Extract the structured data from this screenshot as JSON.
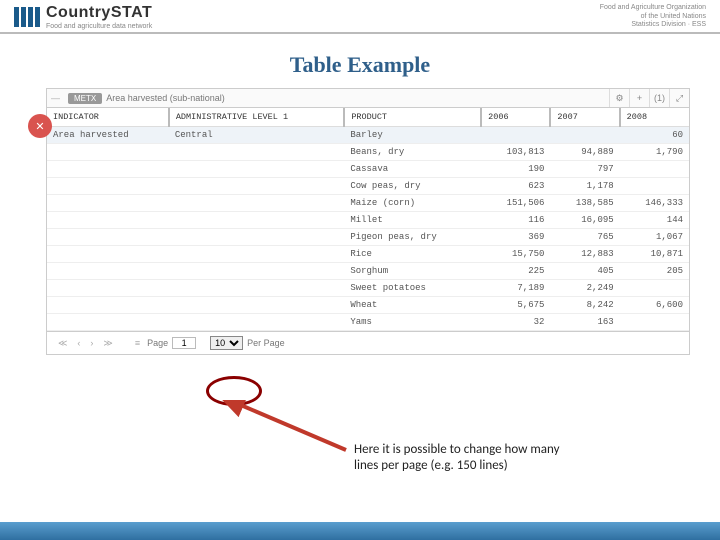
{
  "header": {
    "brand_main": "Country",
    "brand_stat": "STAT",
    "brand_sub": "Food and agriculture data network",
    "fao_line1": "Food and Agriculture Organization",
    "fao_line2": "of the United Nations",
    "fao_line3": "Statistics Division · ESS"
  },
  "title": "Table Example",
  "badge": "METX",
  "topic": "Area harvested (sub-national)",
  "toolbar_count": "(1)",
  "columns": {
    "c0": "INDICATOR",
    "c1": "ADMINISTRATIVE LEVEL 1",
    "c2": "PRODUCT",
    "c3": "2006",
    "c4": "2007",
    "c5": "2008"
  },
  "rows": [
    {
      "ind": "Area harvested",
      "admin": "Central",
      "prod": "Barley",
      "y06": "",
      "y07": "",
      "y08": "60",
      "hl": true
    },
    {
      "ind": "",
      "admin": "",
      "prod": "Beans, dry",
      "y06": "103,813",
      "y07": "94,889",
      "y08": "1,790"
    },
    {
      "ind": "",
      "admin": "",
      "prod": "Cassava",
      "y06": "190",
      "y07": "797",
      "y08": ""
    },
    {
      "ind": "",
      "admin": "",
      "prod": "Cow peas, dry",
      "y06": "623",
      "y07": "1,178",
      "y08": ""
    },
    {
      "ind": "",
      "admin": "",
      "prod": "Maize (corn)",
      "y06": "151,506",
      "y07": "138,585",
      "y08": "146,333"
    },
    {
      "ind": "",
      "admin": "",
      "prod": "Millet",
      "y06": "116",
      "y07": "16,095",
      "y08": "144"
    },
    {
      "ind": "",
      "admin": "",
      "prod": "Pigeon peas, dry",
      "y06": "369",
      "y07": "765",
      "y08": "1,067"
    },
    {
      "ind": "",
      "admin": "",
      "prod": "Rice",
      "y06": "15,750",
      "y07": "12,883",
      "y08": "10,871"
    },
    {
      "ind": "",
      "admin": "",
      "prod": "Sorghum",
      "y06": "225",
      "y07": "405",
      "y08": "205"
    },
    {
      "ind": "",
      "admin": "",
      "prod": "Sweet potatoes",
      "y06": "7,189",
      "y07": "2,249",
      "y08": ""
    },
    {
      "ind": "",
      "admin": "",
      "prod": "Wheat",
      "y06": "5,675",
      "y07": "8,242",
      "y08": "6,600"
    },
    {
      "ind": "",
      "admin": "",
      "prod": "Yams",
      "y06": "32",
      "y07": "163",
      "y08": ""
    }
  ],
  "pager": {
    "page_label": "Page",
    "page_value": "1",
    "per_value": "10",
    "per_label": "Per Page"
  },
  "callout_l1": "Here it is possible to change how many",
  "callout_l2": "lines per page (e.g. 150 lines)"
}
